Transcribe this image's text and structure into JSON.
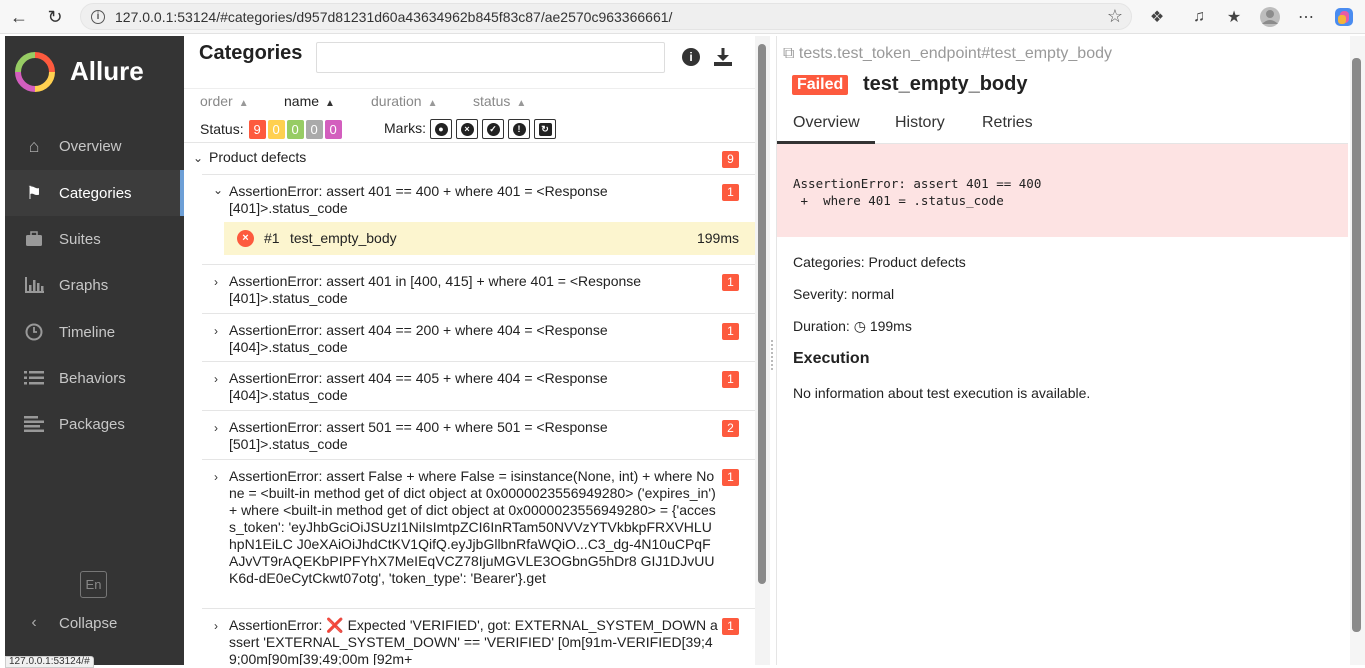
{
  "browser": {
    "url": "127.0.0.1:53124/#categories/d957d81231d60a43634962b845f83c87/ae2570c963366661/",
    "status_url": "127.0.0.1:53124/#"
  },
  "sidebar": {
    "brand": "Allure",
    "items": [
      {
        "label": "Overview",
        "icon": "home-icon"
      },
      {
        "label": "Categories",
        "icon": "flag-icon"
      },
      {
        "label": "Suites",
        "icon": "briefcase-icon"
      },
      {
        "label": "Graphs",
        "icon": "bar-chart-icon"
      },
      {
        "label": "Timeline",
        "icon": "clock-icon"
      },
      {
        "label": "Behaviors",
        "icon": "list-icon"
      },
      {
        "label": "Packages",
        "icon": "align-left-icon"
      }
    ],
    "language": "En",
    "collapse": "Collapse"
  },
  "categories": {
    "title": "Categories",
    "search_value": "",
    "sort": [
      {
        "label": "order"
      },
      {
        "label": "name"
      },
      {
        "label": "duration"
      },
      {
        "label": "status"
      }
    ],
    "status_label": "Status:",
    "status_counts": [
      {
        "value": "9",
        "color": "#fd5a3e"
      },
      {
        "value": "0",
        "color": "#ffd050"
      },
      {
        "value": "0",
        "color": "#97cc64"
      },
      {
        "value": "0",
        "color": "#aaaaaa"
      },
      {
        "value": "0",
        "color": "#d35ebe"
      }
    ],
    "marks_label": "Marks:",
    "group": {
      "title": "Product defects",
      "count": "9"
    },
    "rows": [
      {
        "text": "AssertionError: assert 401 == 400 + where 401 = <Response [401]>.status_code",
        "count": "1",
        "expanded": true
      },
      {
        "text": "AssertionError: assert 401 in [400, 415] + where 401 = <Response [401]>.status_code",
        "count": "1"
      },
      {
        "text": "AssertionError: assert 404 == 200 + where 404 = <Response [404]>.status_code",
        "count": "1"
      },
      {
        "text": "AssertionError: assert 404 == 405 + where 404 = <Response [404]>.status_code",
        "count": "1"
      },
      {
        "text": "AssertionError: assert 501 == 400 + where 501 = <Response [501]>.status_code",
        "count": "2"
      },
      {
        "text": "AssertionError: assert False + where False = isinstance(None, int) + where None = <built-in method get of dict object at 0x0000023556949280> ('expires_in') + where <built-in method get of dict object at 0x0000023556949280> = {'access_token': 'eyJhbGciOiJSUzI1NiIsImtpZCI6InRTam50NVVzYTVkbkpFRXVHLUhpN1EiLC J0eXAiOiJhdCtKV1QifQ.eyJjbGllbnRfaWQiO...C3_dg-4N10uCPqFAJvVT9rAQEKbPIPFYhX7MeIEqVCZ78IjuMGVLE3OGbnG5hDr8 GIJ1DJvUUK6d-dE0eCytCkwt07otg', 'token_type': 'Bearer'}.get",
        "count": "1"
      },
      {
        "text": "AssertionError: ❌ Expected 'VERIFIED', got: EXTERNAL_SYSTEM_DOWN assert 'EXTERNAL_SYSTEM_DOWN' == 'VERIFIED' \u001b[0m\u001b[91m-VERIFIED\u001b[39;49;00m\u001b[90m\u001b[39;49;00m \u001b[92m+",
        "count": "1"
      }
    ],
    "test": {
      "num": "#1",
      "name": "test_empty_body",
      "duration": "199ms"
    }
  },
  "detail": {
    "crumb": "tests.test_token_endpoint#test_empty_body",
    "status": "Failed",
    "title": "test_empty_body",
    "tabs": [
      "Overview",
      "History",
      "Retries"
    ],
    "error": "AssertionError: assert 401 == 400\n +  where 401 = .status_code",
    "categories": "Categories: Product defects",
    "severity": "Severity: normal",
    "duration_label": "Duration:",
    "duration": "199ms",
    "execution_title": "Execution",
    "execution_text": "No information about test execution is available."
  }
}
